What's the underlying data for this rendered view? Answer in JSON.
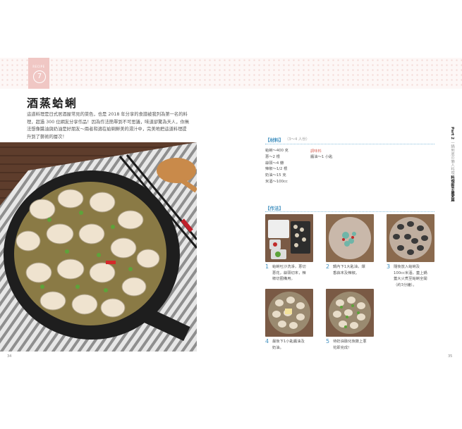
{
  "recipe": {
    "badge_sub": "RECIPE",
    "number": "7",
    "title": "酒蒸蛤蜊",
    "intro": "這道料理是日式居酒屋常見的菜色，也是 2018 年分享的食譜被我列為第一名的料理，超過 300 位網友分享作品！因為作法簡單到不可思議，味道卻驚為天人，你無法想像醬油與奶油是好朋友～兩者和適在蛤蜊鮮美的湯汁中，完美地把這道料理提升到了藝術的層次！"
  },
  "ingredients": {
    "label": "【材料】",
    "serving": "（3～4 人份）",
    "items": [
      "蛤蜊～400 克",
      "蔥～2 根",
      "蒜頭～4 瓣",
      "辣椒～1/2 根",
      "奶油～15 克",
      "米酒～100cc"
    ],
    "seasoning_label": "調味料",
    "seasoning_items": [
      "醬油～1 小匙"
    ]
  },
  "method": {
    "label": "【作法】",
    "steps": [
      {
        "num": "1",
        "text": "蛤蜊吐沙洗淨，蔥切蔥花，蒜頭切末，辣椒切圈備用。"
      },
      {
        "num": "2",
        "text": "鍋內下1大匙油，爆香蒜末及辣椒。"
      },
      {
        "num": "3",
        "text": "隨後放入蛤蜊及100cc米酒，蓋上鍋蓋大火煮至蛤蜊全開（約3分鐘）。"
      },
      {
        "num": "4",
        "text": "最後下1小匙醬油及奶油。"
      },
      {
        "num": "5",
        "text": "待奶油融化後撒上蔥花即完成！"
      }
    ]
  },
  "side_tab": {
    "part": "Part 2",
    "subtitle": "一鍋到底の懶人料理",
    "title": "料理新手最愛篇"
  },
  "page_left": "34",
  "page_right": "35",
  "colors": {
    "accent_blue": "#3f8fbf",
    "badge_pink": "#f0c7c4",
    "seasoning_red": "#d96b5f"
  }
}
